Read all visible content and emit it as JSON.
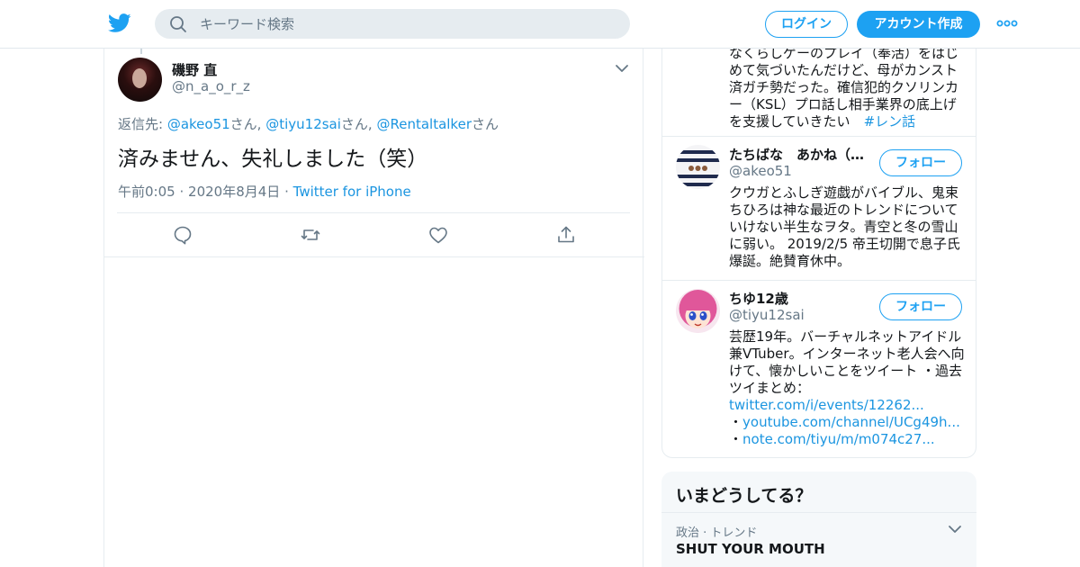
{
  "header": {
    "search_placeholder": "キーワード検索",
    "login_label": "ログイン",
    "signup_label": "アカウント作成"
  },
  "tweet": {
    "author_name": "磯野 直",
    "author_handle": "@n_a_o_r_z",
    "reply_prefix": "返信先: ",
    "reply_to": [
      {
        "handle": "@akeo51",
        "suffix": "さん, "
      },
      {
        "handle": "@tiyu12sai",
        "suffix": "さん, "
      },
      {
        "handle": "@Rentaltalker",
        "suffix": "さん"
      }
    ],
    "text": "済みません、失礼しました（笑）",
    "time": "午前0:05",
    "date": "2020年8月4日",
    "source": "Twitter for iPhone",
    "meta_sep": "·"
  },
  "sidebar": {
    "top_bio": {
      "text": "なくらしゲーのプレイ（奉活）をはじめて気づいたんだけど、母がカンスト済ガチ勢だった。確信犯的クソリンカー（KSL）プロ話し相手業界の底上げを支援していきたい　",
      "hashtag": "#レン話"
    },
    "users": [
      {
        "name": "たちばな　あかね（1…",
        "handle": "@akeo51",
        "follow_label": "フォロー",
        "bio": "クウガとふしぎ遊戯がバイブル、鬼束ちひろは神な最近のトレンドについていけない半生なヲタ。青空と冬の雪山に弱い。 2019/2/5 帝王切開で息子氏爆誕。絶賛育休中。"
      },
      {
        "name": "ちゆ12歳",
        "handle": "@tiyu12sai",
        "follow_label": "フォロー",
        "bio": "芸歴19年。バーチャルネットアイドル兼VTuber。インターネット老人会へ向けて、懐かしいことをツイート ・過去ツイまとめ：",
        "links": [
          "twitter.com/i/events/12262...",
          "youtube.com/channel/UCg49h...",
          "note.com/tiyu/m/m074c27..."
        ],
        "bullet": "・"
      }
    ]
  },
  "trends": {
    "title": "いまどうしてる？",
    "items": [
      {
        "context": "政治 · トレンド",
        "name": "SHUT YOUR MOUTH"
      }
    ]
  },
  "colors": {
    "brand": "#1da1f2",
    "link": "#1b95e0",
    "muted": "#657786",
    "border": "#e6ecf0"
  },
  "icons": [
    "twitter-bird-icon",
    "search-icon",
    "more-dots-icon",
    "chevron-down-icon",
    "reply-icon",
    "retweet-icon",
    "like-icon",
    "share-icon"
  ]
}
